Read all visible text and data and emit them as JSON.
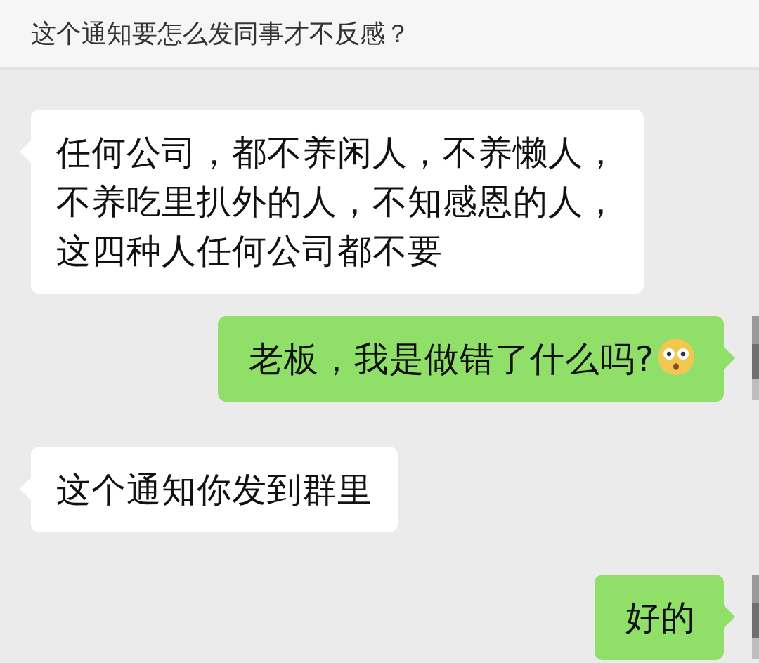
{
  "header": {
    "title": "这个通知要怎么发同事才不反感？"
  },
  "messages": [
    {
      "kind": "incoming",
      "lines": [
        "任何公司，都不养闲人，不养懒人，",
        "不养吃里扒外的人，不知感恩的人，",
        "这四种人任何公司都不要"
      ]
    },
    {
      "kind": "outgoing",
      "lines": [
        "老板，我是做错了什么吗?"
      ],
      "emoji": true
    },
    {
      "kind": "incoming",
      "lines": [
        "这个通知你发到群里"
      ]
    },
    {
      "kind": "outgoing",
      "lines": [
        "好的"
      ]
    }
  ]
}
